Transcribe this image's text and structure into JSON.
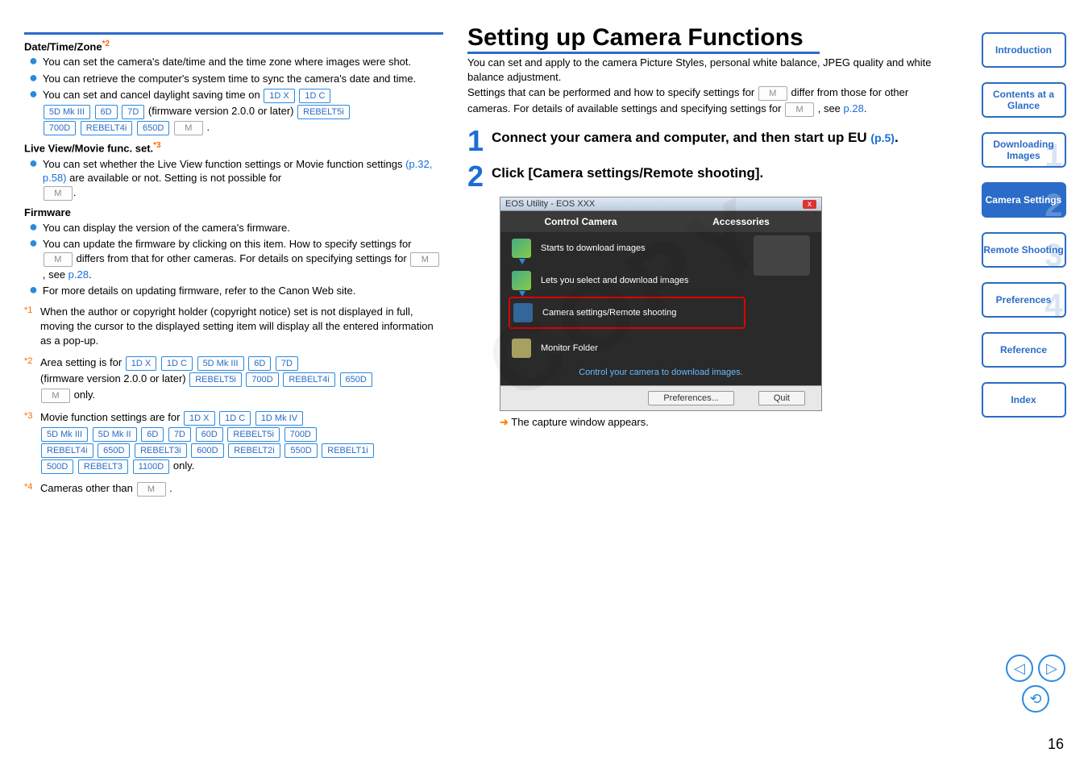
{
  "leftColumn": {
    "section1": {
      "heading": "Date/Time/Zone",
      "sup": "*2",
      "bullets": [
        "You can set the camera's date/time and the time zone where images were shot.",
        "You can retrieve the computer's system time to sync the camera's date and time."
      ],
      "bullet3_pre": "You can set and cancel daylight saving time on ",
      "badges_line1": [
        "1D X",
        "1D C"
      ],
      "badges_line2_a": [
        "5D Mk III",
        "6D",
        "7D"
      ],
      "firm_text": " (firmware version 2.0.0 or later) ",
      "badges_line2_b": [
        "REBELT5i"
      ],
      "badges_line3": [
        "700D",
        "REBELT4i",
        "650D"
      ],
      "m_badge": "M",
      "period": "."
    },
    "section2": {
      "heading": "Live View/Movie func. set.",
      "sup": "*3",
      "bullet_pre": "You can set whether the Live View function settings or Movie function settings ",
      "link": "(p.32, p.58)",
      "bullet_post": " are available or not. Setting is not possible for ",
      "m_badge": "M",
      "period": "."
    },
    "section3": {
      "heading": "Firmware",
      "bullets": [
        "You can display the version of the camera's firmware."
      ],
      "bullet2_pre": "You can update the firmware by clicking on this item. How to specify settings for ",
      "m_badge": "M",
      "bullet2_mid": " differs from that for other cameras. For details on specifying settings for ",
      "see": ", see ",
      "p28": "p.28",
      "period": ".",
      "bullet3": "For more details on updating firmware, refer to the Canon Web site."
    },
    "footnotes": {
      "f1": {
        "num": "*1",
        "text": "When the author or copyright holder (copyright notice) set is not displayed in full, moving the cursor to the displayed setting item will display all the entered information as a pop-up."
      },
      "f2": {
        "num": "*2",
        "pre": "Area setting is for ",
        "badges1": [
          "1D X",
          "1D C",
          "5D Mk III",
          "6D",
          "7D"
        ],
        "firm": "(firmware version 2.0.0 or later) ",
        "badges2": [
          "REBELT5i",
          "700D",
          "REBELT4i",
          "650D"
        ],
        "m_badge": "M",
        "only": " only."
      },
      "f3": {
        "num": "*3",
        "pre": "Movie function settings are for ",
        "badges1": [
          "1D X",
          "1D C",
          "1D Mk IV"
        ],
        "badges2": [
          "5D Mk III",
          "5D Mk II",
          "6D",
          "7D",
          "60D",
          "REBELT5i",
          "700D"
        ],
        "badges3": [
          "REBELT4i",
          "650D",
          "REBELT3i",
          "600D",
          "REBELT2i",
          "550D",
          "REBELT1i"
        ],
        "badges4": [
          "500D",
          "REBELT3",
          "1100D"
        ],
        "only": " only."
      },
      "f4": {
        "num": "*4",
        "pre": "Cameras other than ",
        "m_badge": "M",
        "period": "."
      }
    }
  },
  "midColumn": {
    "title": "Setting up Camera Functions",
    "intro1": "You can set and apply to the camera Picture Styles, personal white balance, JPEG quality and white balance adjustment.",
    "intro2_pre": "Settings that can be performed and how to specify settings for ",
    "m_badge": "M",
    "intro2_mid": " differ from those for other cameras. For details of available settings and specifying settings for ",
    "see": ", see ",
    "p28": "p.28",
    "period": ".",
    "step1": {
      "num": "1",
      "text_pre": "Connect your camera and computer, and then start up EU ",
      "link": "(p.5)",
      "period": "."
    },
    "step2": {
      "num": "2",
      "text": "Click [Camera settings/Remote shooting]."
    },
    "screenshot": {
      "title": "EOS Utility - EOS XXX",
      "close": "x",
      "tab1": "Control Camera",
      "tab2": "Accessories",
      "row1": "Starts to download images",
      "row2": "Lets you select and download images",
      "row3": "Camera settings/Remote shooting",
      "row4": "Monitor Folder",
      "status": "Control your camera to download images.",
      "pref": "Preferences...",
      "quit": "Quit"
    },
    "note": "The capture window appears."
  },
  "nav": {
    "intro": "Introduction",
    "contents": "Contents at a Glance",
    "down": {
      "label": "Downloading Images",
      "num": "1"
    },
    "cam": {
      "label": "Camera Settings",
      "num": "2"
    },
    "remote": {
      "label": "Remote Shooting",
      "num": "3"
    },
    "pref": {
      "label": "Preferences",
      "num": "4"
    },
    "ref": "Reference",
    "index": "Index"
  },
  "pageNumber": "16",
  "watermark": "COPY"
}
